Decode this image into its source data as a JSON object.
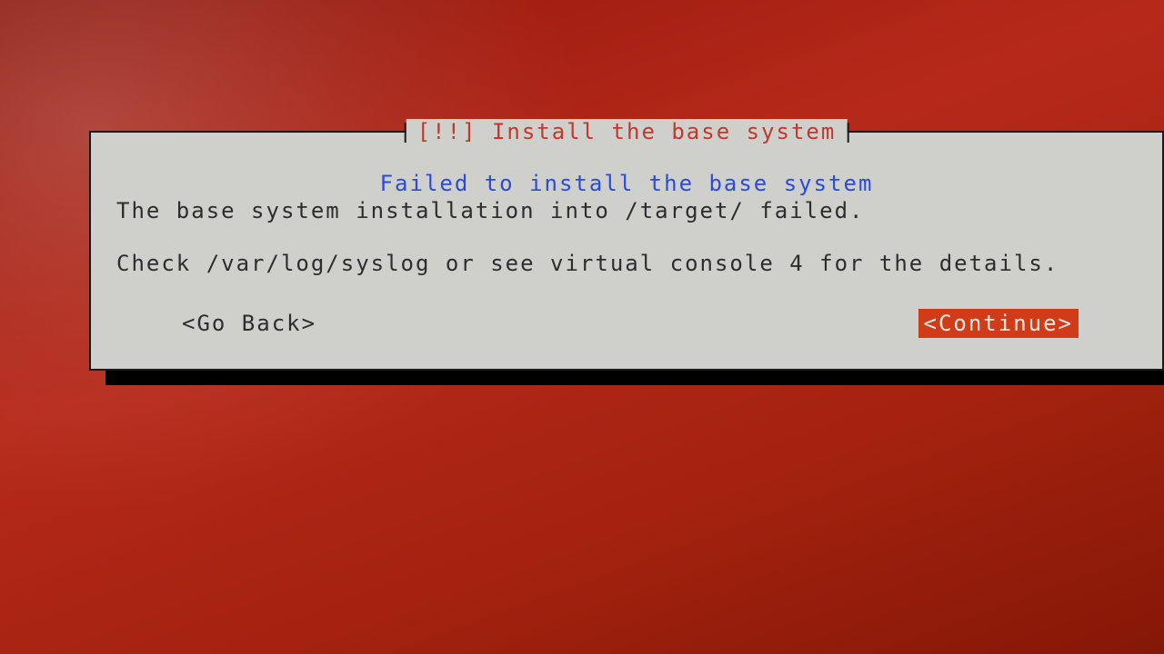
{
  "dialog": {
    "title": "[!!] Install the base system",
    "error_heading": "Failed to install the base system",
    "message_line1": "The base system installation into /target/ failed.",
    "message_line2": "Check /var/log/syslog or see virtual console 4 for the details.",
    "buttons": {
      "back": "<Go Back>",
      "continue": "<Continue>"
    }
  },
  "colors": {
    "background": "#a4220f",
    "dialog_bg": "#cfd0cc",
    "title_fg": "#c0392b",
    "error_fg": "#2b4bd6",
    "selected_bg": "#d23b18",
    "selected_fg": "#eceae3"
  }
}
